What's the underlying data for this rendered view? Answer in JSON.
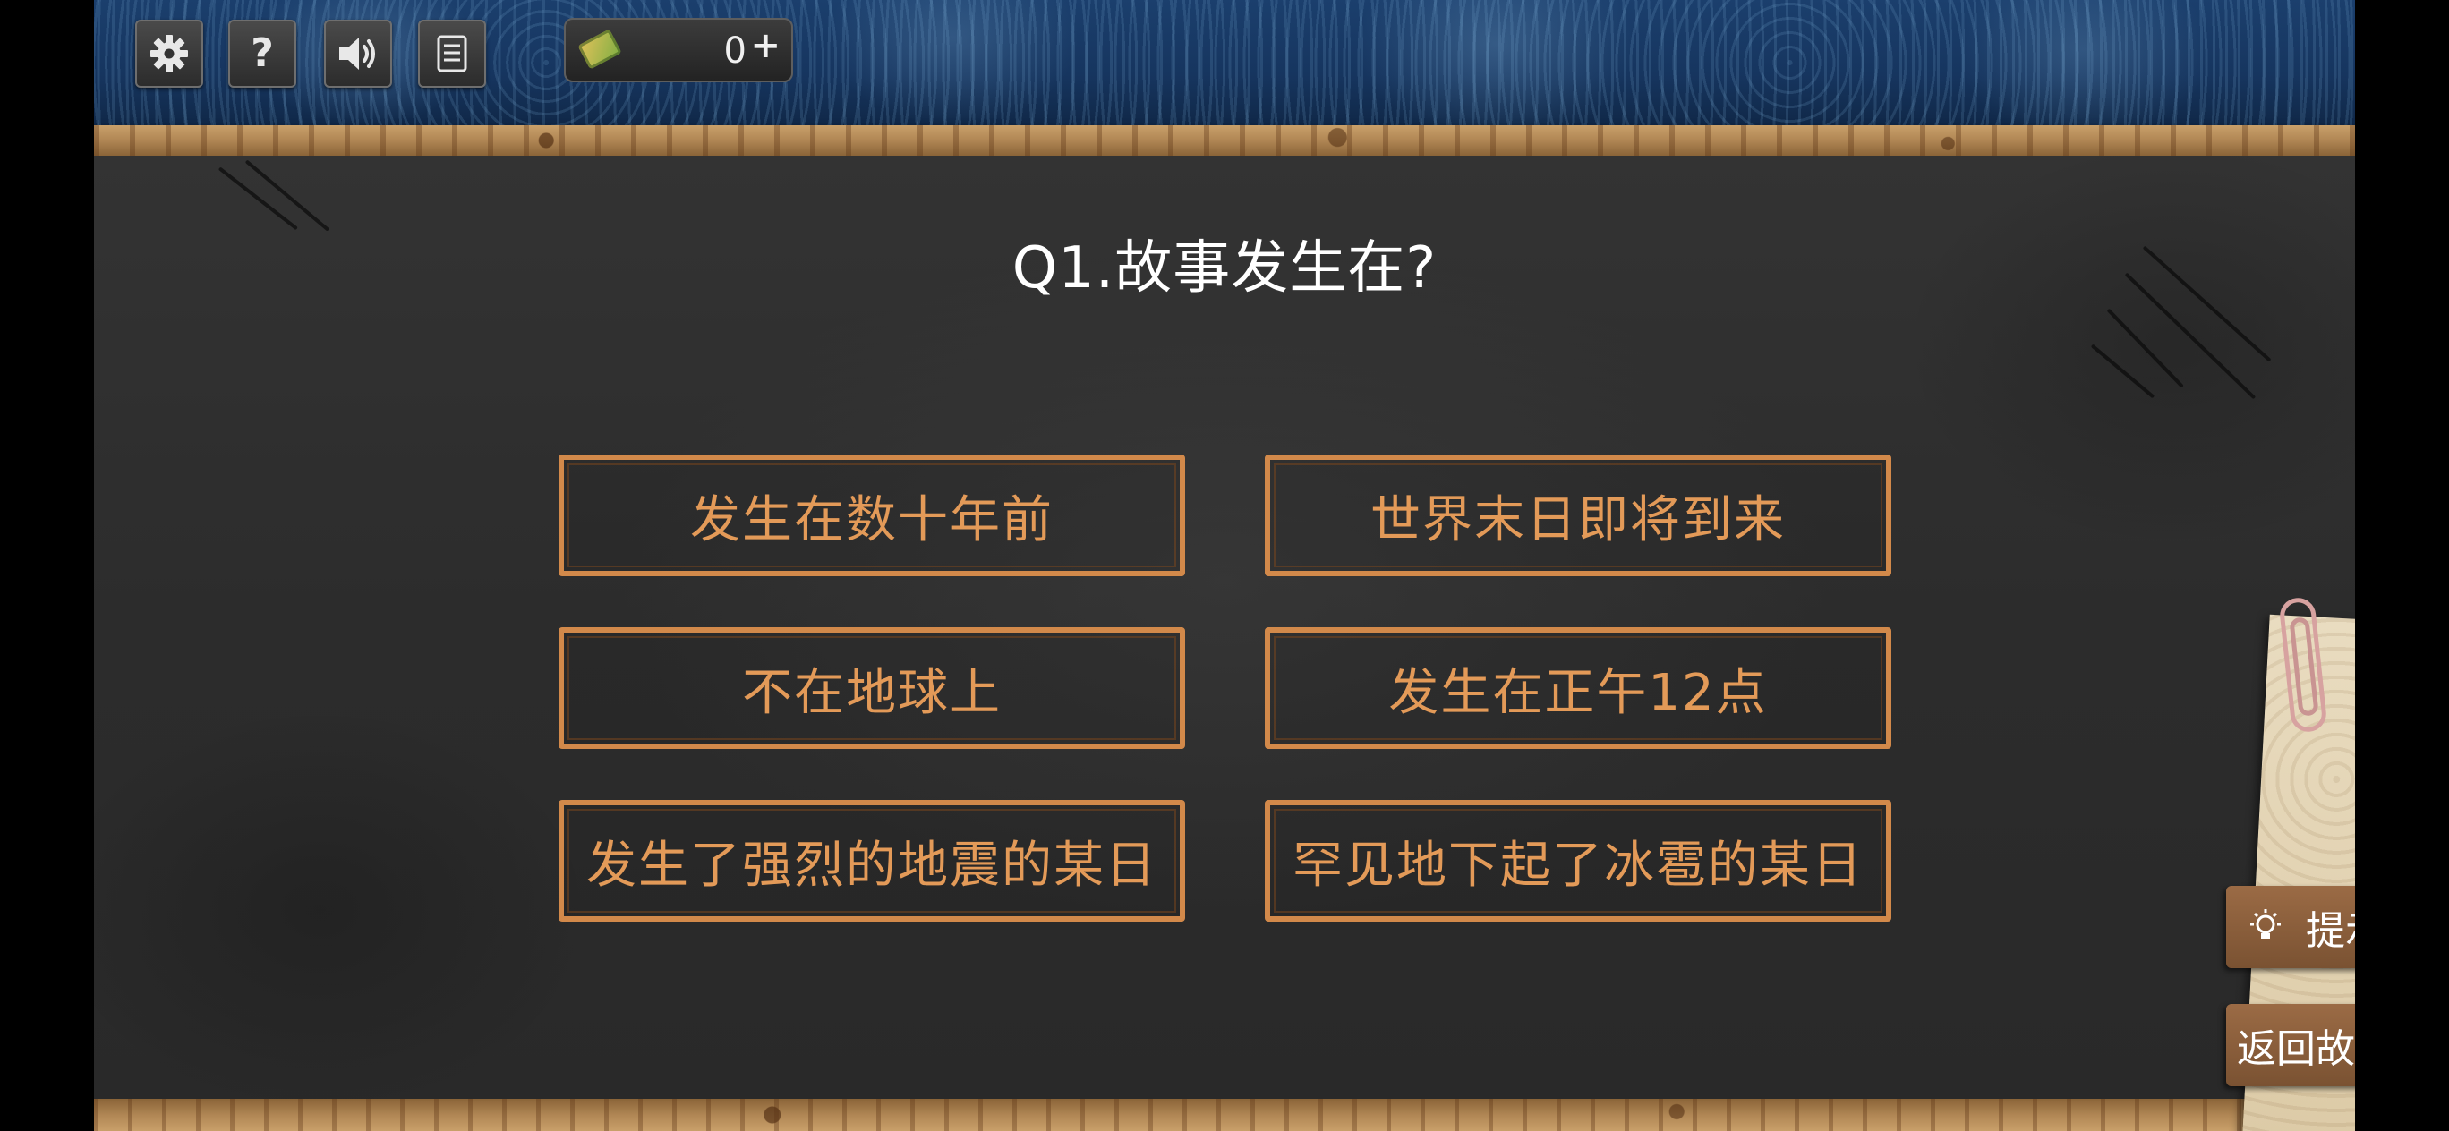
{
  "toolbar": {
    "settings_icon": "gear-icon",
    "help_glyph": "?",
    "sound_icon": "speaker-icon",
    "notes_icon": "document-icon",
    "ticket_count": "0",
    "ticket_plus": "+"
  },
  "quiz": {
    "question": "Q1.故事发生在?",
    "options": [
      "发生在数十年前",
      "世界末日即将到来",
      "不在地球上",
      "发生在正午12点",
      "发生了强烈的地震的某日",
      "罕见地下起了冰雹的某日"
    ]
  },
  "side": {
    "hint_label": "提示",
    "back_label": "返回故事"
  },
  "colors": {
    "option_text": "#e39a58",
    "option_border": "#d2894a",
    "board": "#2f2f2f",
    "side_button": "#8b5e3c"
  }
}
